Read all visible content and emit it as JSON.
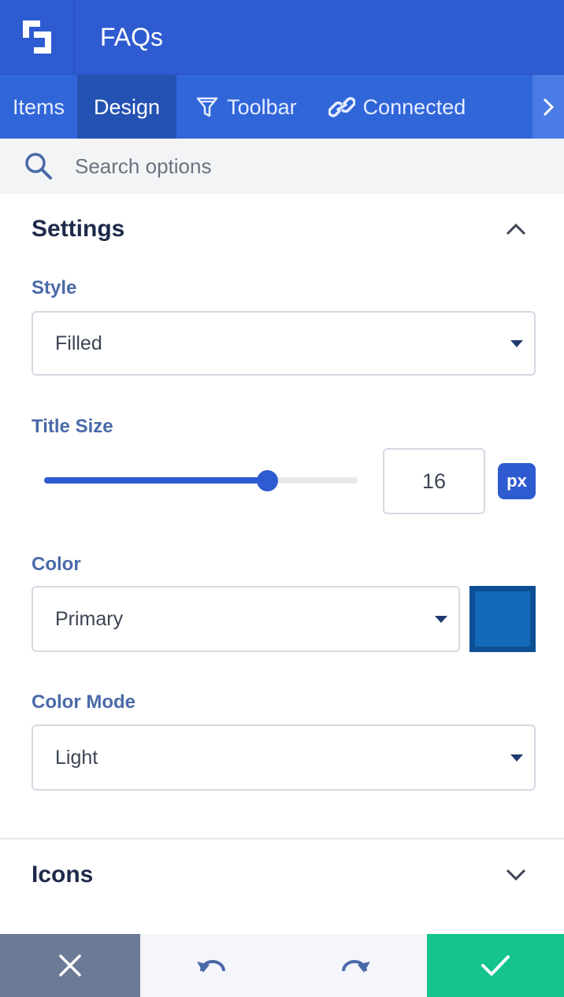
{
  "header": {
    "title": "FAQs",
    "logo": "builder-logo-icon"
  },
  "tabs": [
    {
      "label": "Items",
      "icon": null,
      "active": false
    },
    {
      "label": "Design",
      "icon": null,
      "active": true
    },
    {
      "label": "Toolbar",
      "icon": "filter-icon",
      "active": false
    },
    {
      "label": "Connected",
      "icon": "link-icon",
      "active": false
    }
  ],
  "search": {
    "placeholder": "Search options",
    "value": ""
  },
  "settings": {
    "title": "Settings",
    "expanded": true,
    "style": {
      "label": "Style",
      "value": "Filled"
    },
    "title_size": {
      "label": "Title Size",
      "value": "16",
      "unit": "px",
      "slider_fraction": 0.71
    },
    "color": {
      "label": "Color",
      "value": "Primary",
      "swatch": "#1468b8"
    },
    "color_mode": {
      "label": "Color Mode",
      "value": "Light"
    }
  },
  "icons_section": {
    "title": "Icons",
    "expanded": false
  },
  "colors": {
    "primary": "#2f5bd0",
    "confirm": "#14c38e",
    "cancel": "#6b7a96"
  }
}
